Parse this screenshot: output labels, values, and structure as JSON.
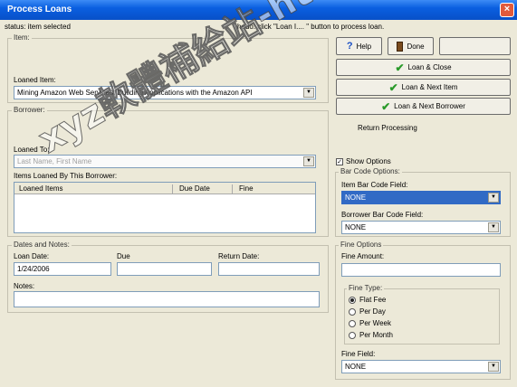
{
  "window": {
    "title": "Process Loans",
    "close_glyph": "×"
  },
  "status": {
    "left": "status: item selected",
    "right": "hedo: click \"Loan I.... \" button to process loan."
  },
  "item": {
    "group_label": "Item:",
    "loaned_item_label": "Loaned Item:",
    "loaned_item_value": "Mining Amazon Web Services: Building Applications with the Amazon API"
  },
  "borrower": {
    "group_label": "Borrower:",
    "loaned_to_label": "Loaned To:",
    "loaned_to_value": "Last Name, First Name",
    "items_loaned_label": "Items Loaned By This Borrower:",
    "columns": [
      "Loaned Items",
      "Due Date",
      "Fine"
    ]
  },
  "dates": {
    "group_label": "Dates and Notes:",
    "loan_date_label": "Loan Date:",
    "loan_date_value": "1/24/2006",
    "due_date_label": "Due",
    "return_date_label": "Return Date:",
    "notes_label": "Notes:"
  },
  "buttons": {
    "help": "Help",
    "done": "Done",
    "loan_close": "Loan & Close",
    "loan_next_item": "Loan & Next Item",
    "loan_next_borrower": "Loan & Next Borrower",
    "return_processing": "Return Processing"
  },
  "options": {
    "show_options": "Show Options",
    "show_options_checked": true
  },
  "barcode": {
    "group_label": "Bar Code Options:",
    "item_field_label": "Item Bar Code Field:",
    "item_field_value": "NONE",
    "borrower_field_label": "Borrower Bar Code Field:",
    "borrower_field_value": "NONE"
  },
  "fine": {
    "group_label": "Fine Options",
    "amount_label": "Fine Amount:",
    "amount_value": "",
    "type_label": "Fine Type:",
    "types": [
      "Flat Fee",
      "Per Day",
      "Per Week",
      "Per Month"
    ],
    "selected_type": "Flat Fee",
    "field_label": "Fine Field:",
    "field_value": "NONE"
  },
  "watermark": "xyz軟體補給站-http://31.to",
  "colors": {
    "title_bar": "#0a5fe0",
    "selection": "#316ac5",
    "check_icon": "#2a9a2a",
    "status_green": "#2f8a2f",
    "status_red": "#e02020"
  }
}
